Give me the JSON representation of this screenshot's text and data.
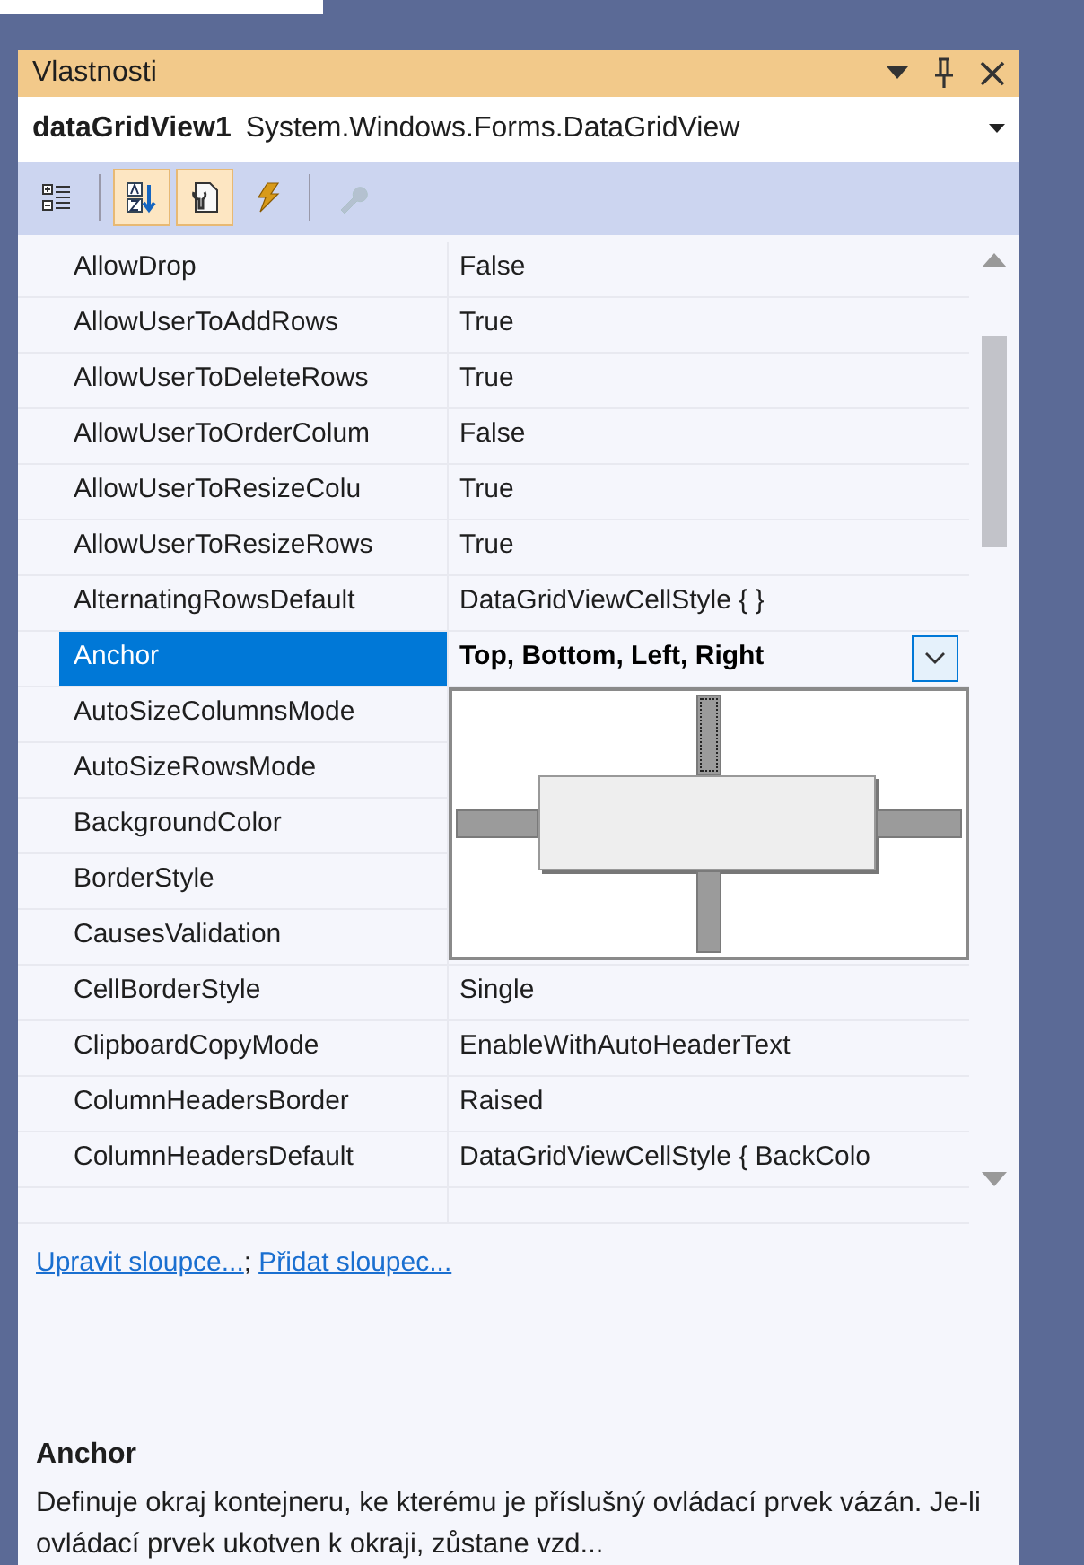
{
  "window": {
    "title": "Vlastnosti"
  },
  "object_selector": {
    "name": "dataGridView1",
    "type": "System.Windows.Forms.DataGridView"
  },
  "toolbar": [
    {
      "kind": "categorized",
      "selected": false,
      "disabled": false
    },
    {
      "kind": "alphabetical",
      "selected": true,
      "disabled": false
    },
    {
      "kind": "properties",
      "selected": true,
      "disabled": false
    },
    {
      "kind": "events",
      "selected": false,
      "disabled": false
    },
    {
      "kind": "property_pages",
      "selected": false,
      "disabled": true
    }
  ],
  "properties": [
    {
      "name": "AllowDrop",
      "value": "False",
      "selected": false,
      "non_default": false
    },
    {
      "name": "AllowUserToAddRows",
      "value": "True",
      "selected": false,
      "non_default": false
    },
    {
      "name": "AllowUserToDeleteRows",
      "value": "True",
      "selected": false,
      "non_default": false
    },
    {
      "name": "AllowUserToOrderColum",
      "value": "False",
      "selected": false,
      "non_default": false
    },
    {
      "name": "AllowUserToResizeColu",
      "value": "True",
      "selected": false,
      "non_default": false
    },
    {
      "name": "AllowUserToResizeRows",
      "value": "True",
      "selected": false,
      "non_default": false
    },
    {
      "name": "AlternatingRowsDefault",
      "value": "DataGridViewCellStyle { }",
      "selected": false,
      "non_default": false
    },
    {
      "name": "Anchor",
      "value": "Top, Bottom, Left, Right",
      "selected": true,
      "non_default": true
    },
    {
      "name": "AutoSizeColumnsMode",
      "selected": false
    },
    {
      "name": "AutoSizeRowsMode",
      "selected": false
    },
    {
      "name": "BackgroundColor",
      "selected": false
    },
    {
      "name": "BorderStyle",
      "selected": false
    },
    {
      "name": "CausesValidation",
      "selected": false
    },
    {
      "name": "CellBorderStyle",
      "value": "Single",
      "selected": false,
      "non_default": false
    },
    {
      "name": "ClipboardCopyMode",
      "value": "EnableWithAutoHeaderText",
      "selected": false,
      "non_default": false
    },
    {
      "name": "ColumnHeadersBorder",
      "value": "Raised",
      "selected": false,
      "non_default": false
    },
    {
      "name": "ColumnHeadersDefault",
      "value": "DataGridViewCellStyle { BackColo",
      "selected": false,
      "non_default": false
    }
  ],
  "anchor_editor": {
    "top": true,
    "bottom": true,
    "left": true,
    "right": true
  },
  "commands": [
    "Upravit sloupce...",
    ";",
    "Přidat sloupec..."
  ],
  "description": {
    "title": "Anchor",
    "text": "Definuje okraj kontejneru, ke kterému je příslušný ovládací prvek vázán. Je-li ovládací prvek ukotven k okraji, zůstane vzd..."
  }
}
